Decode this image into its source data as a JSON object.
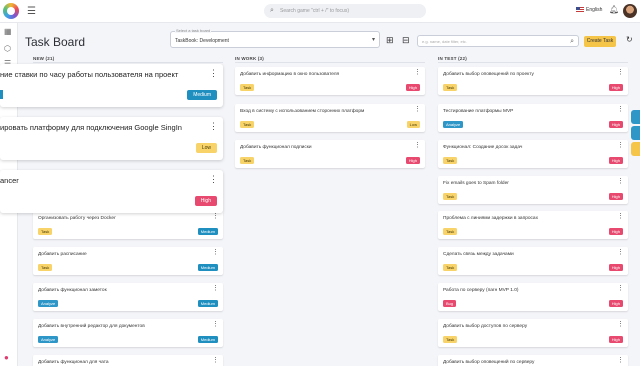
{
  "topbar": {
    "search_placeholder": "Search game \"ctrl + /\" to focus)",
    "language": "English"
  },
  "page": {
    "title": "Task Board",
    "board_select_label": "Select a task board",
    "board_select_value": "TaskBook: Development",
    "filter_placeholder": "e.g. name, date filter, etc.",
    "create_label": "Create Task"
  },
  "columns": [
    {
      "title": "NEW (21)",
      "cards": [
        {
          "title": "Организовать работу через Docker",
          "tag": "Task",
          "priority": "Medium"
        },
        {
          "title": "Добавить расписание",
          "tag": "Task",
          "priority": "Medium"
        },
        {
          "title": "Добавить функционал заметок",
          "tag": "Analyze",
          "priority": "Medium"
        },
        {
          "title": "Добавить внутренний редактор для документов",
          "tag": "Analyze",
          "priority": "Medium"
        },
        {
          "title": "Добавить функционал для чата",
          "tag": "",
          "priority": ""
        }
      ]
    },
    {
      "title": "IN WORK (3)",
      "cards": [
        {
          "title": "Добавить информацию в окно пользователя",
          "tag": "Task",
          "priority": "High"
        },
        {
          "title": "Вход в систему с использованием сторонних платформ",
          "tag": "Task",
          "priority": "Low"
        },
        {
          "title": "Добавить функционал подписки",
          "tag": "Task",
          "priority": "High"
        }
      ]
    },
    {
      "title": "IN TEST (22)",
      "cards": [
        {
          "title": "Добавить выбор оповещений по проекту",
          "tag": "Task",
          "priority": "High"
        },
        {
          "title": "Тестирование платформы MVP",
          "tag": "Analyze",
          "priority": "High"
        },
        {
          "title": "Функционал: Создание досок задач",
          "tag": "Task",
          "priority": "High"
        },
        {
          "title": "Fix emails goes to Spam folder",
          "tag": "Task",
          "priority": "High"
        },
        {
          "title": "Проблема с линиями задержки в запросах",
          "tag": "Task",
          "priority": "High"
        },
        {
          "title": "Сделать связь между задачами",
          "tag": "Task",
          "priority": "High"
        },
        {
          "title": "Работа по серверу (пагн MVP 1.0)",
          "tag": "Bug",
          "priority": "High"
        },
        {
          "title": "Добавить выбор доступов по серверу",
          "tag": "Task",
          "priority": "High"
        },
        {
          "title": "Добавить выбор оповещений по серверу",
          "tag": "",
          "priority": ""
        }
      ]
    }
  ],
  "floating_cards": [
    {
      "title": "ние ставки по часу работы пользователя на проект",
      "priority": "Medium"
    },
    {
      "title": "ировать платформу для подключения Google SingIn",
      "priority": "Low"
    },
    {
      "title": "ancer",
      "priority": "High"
    }
  ],
  "colors": {
    "accent_yellow": "#f5c54a",
    "high": "#e8496f",
    "medium": "#1f8fc0",
    "analyze": "#2f96c8"
  }
}
